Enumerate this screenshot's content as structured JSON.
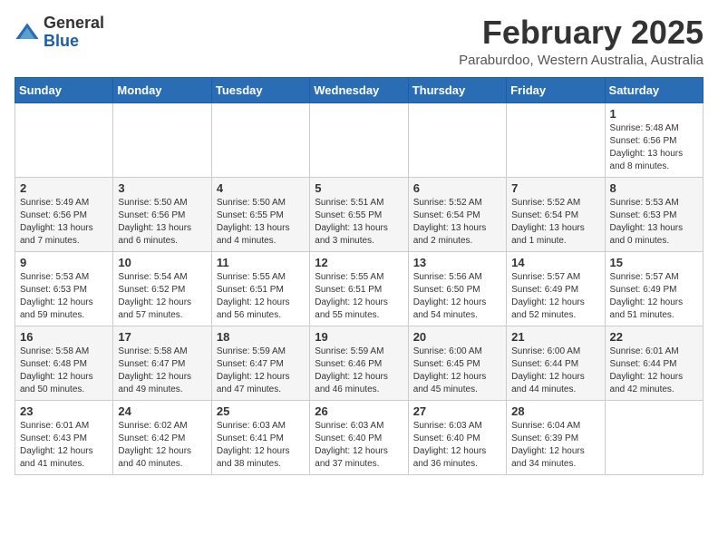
{
  "header": {
    "logo_general": "General",
    "logo_blue": "Blue",
    "month_title": "February 2025",
    "location": "Paraburdoo, Western Australia, Australia"
  },
  "days_of_week": [
    "Sunday",
    "Monday",
    "Tuesday",
    "Wednesday",
    "Thursday",
    "Friday",
    "Saturday"
  ],
  "weeks": [
    [
      {
        "day": "",
        "info": ""
      },
      {
        "day": "",
        "info": ""
      },
      {
        "day": "",
        "info": ""
      },
      {
        "day": "",
        "info": ""
      },
      {
        "day": "",
        "info": ""
      },
      {
        "day": "",
        "info": ""
      },
      {
        "day": "1",
        "info": "Sunrise: 5:48 AM\nSunset: 6:56 PM\nDaylight: 13 hours and 8 minutes."
      }
    ],
    [
      {
        "day": "2",
        "info": "Sunrise: 5:49 AM\nSunset: 6:56 PM\nDaylight: 13 hours and 7 minutes."
      },
      {
        "day": "3",
        "info": "Sunrise: 5:50 AM\nSunset: 6:56 PM\nDaylight: 13 hours and 6 minutes."
      },
      {
        "day": "4",
        "info": "Sunrise: 5:50 AM\nSunset: 6:55 PM\nDaylight: 13 hours and 4 minutes."
      },
      {
        "day": "5",
        "info": "Sunrise: 5:51 AM\nSunset: 6:55 PM\nDaylight: 13 hours and 3 minutes."
      },
      {
        "day": "6",
        "info": "Sunrise: 5:52 AM\nSunset: 6:54 PM\nDaylight: 13 hours and 2 minutes."
      },
      {
        "day": "7",
        "info": "Sunrise: 5:52 AM\nSunset: 6:54 PM\nDaylight: 13 hours and 1 minute."
      },
      {
        "day": "8",
        "info": "Sunrise: 5:53 AM\nSunset: 6:53 PM\nDaylight: 13 hours and 0 minutes."
      }
    ],
    [
      {
        "day": "9",
        "info": "Sunrise: 5:53 AM\nSunset: 6:53 PM\nDaylight: 12 hours and 59 minutes."
      },
      {
        "day": "10",
        "info": "Sunrise: 5:54 AM\nSunset: 6:52 PM\nDaylight: 12 hours and 57 minutes."
      },
      {
        "day": "11",
        "info": "Sunrise: 5:55 AM\nSunset: 6:51 PM\nDaylight: 12 hours and 56 minutes."
      },
      {
        "day": "12",
        "info": "Sunrise: 5:55 AM\nSunset: 6:51 PM\nDaylight: 12 hours and 55 minutes."
      },
      {
        "day": "13",
        "info": "Sunrise: 5:56 AM\nSunset: 6:50 PM\nDaylight: 12 hours and 54 minutes."
      },
      {
        "day": "14",
        "info": "Sunrise: 5:57 AM\nSunset: 6:49 PM\nDaylight: 12 hours and 52 minutes."
      },
      {
        "day": "15",
        "info": "Sunrise: 5:57 AM\nSunset: 6:49 PM\nDaylight: 12 hours and 51 minutes."
      }
    ],
    [
      {
        "day": "16",
        "info": "Sunrise: 5:58 AM\nSunset: 6:48 PM\nDaylight: 12 hours and 50 minutes."
      },
      {
        "day": "17",
        "info": "Sunrise: 5:58 AM\nSunset: 6:47 PM\nDaylight: 12 hours and 49 minutes."
      },
      {
        "day": "18",
        "info": "Sunrise: 5:59 AM\nSunset: 6:47 PM\nDaylight: 12 hours and 47 minutes."
      },
      {
        "day": "19",
        "info": "Sunrise: 5:59 AM\nSunset: 6:46 PM\nDaylight: 12 hours and 46 minutes."
      },
      {
        "day": "20",
        "info": "Sunrise: 6:00 AM\nSunset: 6:45 PM\nDaylight: 12 hours and 45 minutes."
      },
      {
        "day": "21",
        "info": "Sunrise: 6:00 AM\nSunset: 6:44 PM\nDaylight: 12 hours and 44 minutes."
      },
      {
        "day": "22",
        "info": "Sunrise: 6:01 AM\nSunset: 6:44 PM\nDaylight: 12 hours and 42 minutes."
      }
    ],
    [
      {
        "day": "23",
        "info": "Sunrise: 6:01 AM\nSunset: 6:43 PM\nDaylight: 12 hours and 41 minutes."
      },
      {
        "day": "24",
        "info": "Sunrise: 6:02 AM\nSunset: 6:42 PM\nDaylight: 12 hours and 40 minutes."
      },
      {
        "day": "25",
        "info": "Sunrise: 6:03 AM\nSunset: 6:41 PM\nDaylight: 12 hours and 38 minutes."
      },
      {
        "day": "26",
        "info": "Sunrise: 6:03 AM\nSunset: 6:40 PM\nDaylight: 12 hours and 37 minutes."
      },
      {
        "day": "27",
        "info": "Sunrise: 6:03 AM\nSunset: 6:40 PM\nDaylight: 12 hours and 36 minutes."
      },
      {
        "day": "28",
        "info": "Sunrise: 6:04 AM\nSunset: 6:39 PM\nDaylight: 12 hours and 34 minutes."
      },
      {
        "day": "",
        "info": ""
      }
    ]
  ]
}
